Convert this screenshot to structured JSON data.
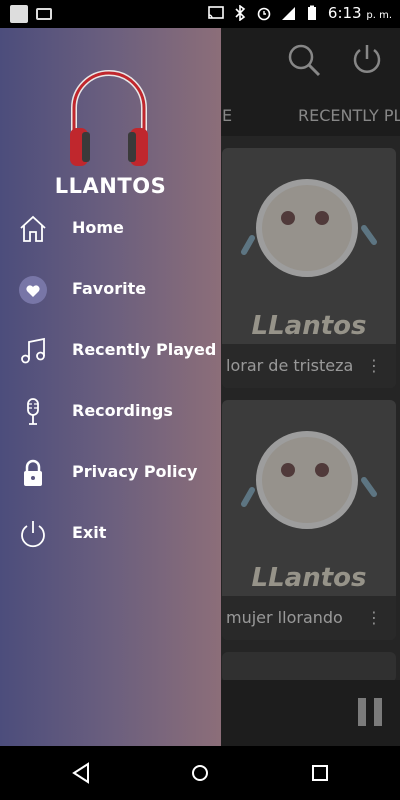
{
  "status_bar": {
    "time": "6:13",
    "ampm": "p. m.",
    "icons": [
      "app-icon",
      "cast-icon",
      "cast-screen-icon",
      "bluetooth-icon",
      "alarm-icon",
      "signal-icon",
      "battery-icon"
    ]
  },
  "background_app": {
    "tabs": [
      "E",
      "RECENTLY PL"
    ],
    "cards": [
      {
        "title": "lorar de tristeza",
        "art_text": "LLantos"
      },
      {
        "title": "mujer llorando",
        "art_text": "LLantos"
      }
    ],
    "icons": [
      "search-icon",
      "power-icon",
      "pause-icon"
    ]
  },
  "drawer": {
    "brand": "LLANTOS",
    "menu": [
      {
        "label": "Home",
        "icon": "home-icon"
      },
      {
        "label": "Favorite",
        "icon": "heart-icon"
      },
      {
        "label": "Recently Played",
        "icon": "music-note-icon"
      },
      {
        "label": "Recordings",
        "icon": "microphone-icon"
      },
      {
        "label": "Privacy Policy",
        "icon": "lock-icon"
      },
      {
        "label": "Exit",
        "icon": "power-icon"
      }
    ]
  },
  "colors": {
    "drawer_left": "#4c4d7c",
    "drawer_right": "#8c6e79",
    "headphone_red": "#c0272d"
  }
}
